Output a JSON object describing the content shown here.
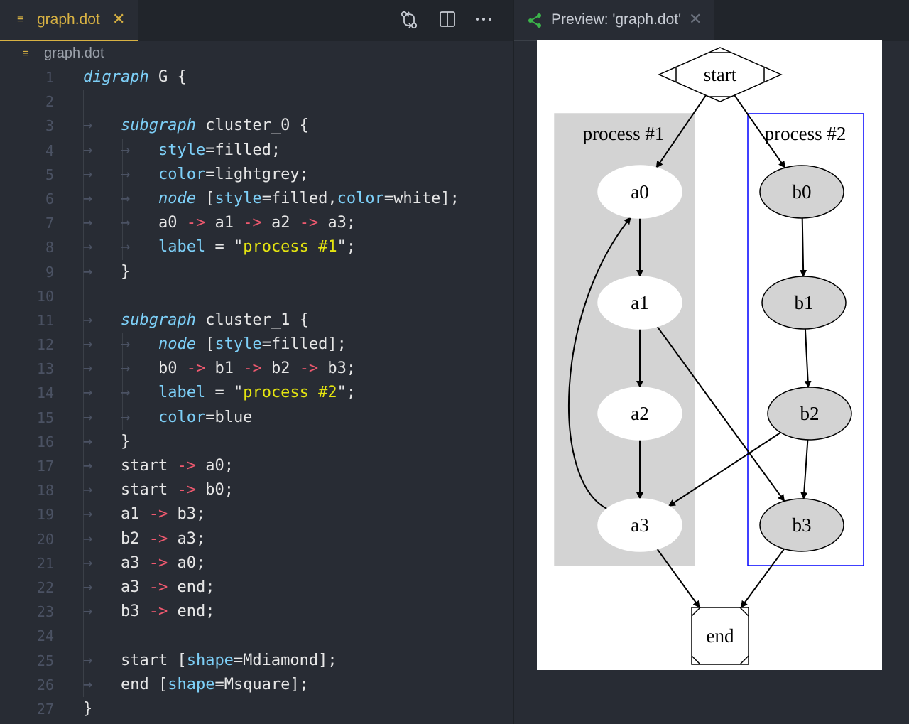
{
  "editor": {
    "tab": {
      "icon": "lines-file-icon",
      "filename": "graph.dot",
      "close_glyph": "✕"
    },
    "actions": [
      {
        "name": "open-changes-icon",
        "glyph": "⇄"
      },
      {
        "name": "split-editor-icon",
        "glyph": "▢"
      },
      {
        "name": "more-actions-icon",
        "glyph": "···"
      }
    ],
    "breadcrumb": {
      "label": "graph.dot"
    }
  },
  "preview": {
    "tab_title": "Preview: 'graph.dot'",
    "close_glyph": "✕",
    "icon": "graph-preview-icon",
    "accent": "#3bb54a"
  },
  "code_lines": [
    {
      "n": "1",
      "indent": 0,
      "tokens": [
        [
          "kw",
          "digraph"
        ],
        [
          "p",
          " G {"
        ]
      ]
    },
    {
      "n": "2",
      "indent": 1,
      "tokens": []
    },
    {
      "n": "3",
      "indent": 1,
      "tokens": [
        [
          "kw",
          "subgraph"
        ],
        [
          "p",
          " cluster_0 {"
        ]
      ]
    },
    {
      "n": "4",
      "indent": 2,
      "tokens": [
        [
          "at",
          "style"
        ],
        [
          "p",
          "=filled;"
        ]
      ]
    },
    {
      "n": "5",
      "indent": 2,
      "tokens": [
        [
          "at",
          "color"
        ],
        [
          "p",
          "=lightgrey;"
        ]
      ]
    },
    {
      "n": "6",
      "indent": 2,
      "tokens": [
        [
          "kw",
          "node"
        ],
        [
          "p",
          " ["
        ],
        [
          "at",
          "style"
        ],
        [
          "p",
          "=filled,"
        ],
        [
          "at",
          "color"
        ],
        [
          "p",
          "=white];"
        ]
      ]
    },
    {
      "n": "7",
      "indent": 2,
      "tokens": [
        [
          "p",
          "a0 "
        ],
        [
          "ar",
          "->"
        ],
        [
          "p",
          " a1 "
        ],
        [
          "ar",
          "->"
        ],
        [
          "p",
          " a2 "
        ],
        [
          "ar",
          "->"
        ],
        [
          "p",
          " a3;"
        ]
      ]
    },
    {
      "n": "8",
      "indent": 2,
      "tokens": [
        [
          "at",
          "label"
        ],
        [
          "p",
          " = "
        ],
        [
          "sq",
          "\""
        ],
        [
          "st",
          "process #1"
        ],
        [
          "sq",
          "\""
        ],
        [
          "p",
          ";"
        ]
      ]
    },
    {
      "n": "9",
      "indent": 1,
      "tokens": [
        [
          "p",
          "}"
        ]
      ]
    },
    {
      "n": "10",
      "indent": 1,
      "tokens": []
    },
    {
      "n": "11",
      "indent": 1,
      "tokens": [
        [
          "kw",
          "subgraph"
        ],
        [
          "p",
          " cluster_1 {"
        ]
      ]
    },
    {
      "n": "12",
      "indent": 2,
      "tokens": [
        [
          "kw",
          "node"
        ],
        [
          "p",
          " ["
        ],
        [
          "at",
          "style"
        ],
        [
          "p",
          "=filled];"
        ]
      ]
    },
    {
      "n": "13",
      "indent": 2,
      "tokens": [
        [
          "p",
          "b0 "
        ],
        [
          "ar",
          "->"
        ],
        [
          "p",
          " b1 "
        ],
        [
          "ar",
          "->"
        ],
        [
          "p",
          " b2 "
        ],
        [
          "ar",
          "->"
        ],
        [
          "p",
          " b3;"
        ]
      ]
    },
    {
      "n": "14",
      "indent": 2,
      "tokens": [
        [
          "at",
          "label"
        ],
        [
          "p",
          " = "
        ],
        [
          "sq",
          "\""
        ],
        [
          "st",
          "process #2"
        ],
        [
          "sq",
          "\""
        ],
        [
          "p",
          ";"
        ]
      ]
    },
    {
      "n": "15",
      "indent": 2,
      "tokens": [
        [
          "at",
          "color"
        ],
        [
          "p",
          "=blue"
        ]
      ]
    },
    {
      "n": "16",
      "indent": 1,
      "tokens": [
        [
          "p",
          "}"
        ]
      ]
    },
    {
      "n": "17",
      "indent": 1,
      "tokens": [
        [
          "p",
          "start "
        ],
        [
          "ar",
          "->"
        ],
        [
          "p",
          " a0;"
        ]
      ]
    },
    {
      "n": "18",
      "indent": 1,
      "tokens": [
        [
          "p",
          "start "
        ],
        [
          "ar",
          "->"
        ],
        [
          "p",
          " b0;"
        ]
      ]
    },
    {
      "n": "19",
      "indent": 1,
      "tokens": [
        [
          "p",
          "a1 "
        ],
        [
          "ar",
          "->"
        ],
        [
          "p",
          " b3;"
        ]
      ]
    },
    {
      "n": "20",
      "indent": 1,
      "tokens": [
        [
          "p",
          "b2 "
        ],
        [
          "ar",
          "->"
        ],
        [
          "p",
          " a3;"
        ]
      ]
    },
    {
      "n": "21",
      "indent": 1,
      "tokens": [
        [
          "p",
          "a3 "
        ],
        [
          "ar",
          "->"
        ],
        [
          "p",
          " a0;"
        ]
      ]
    },
    {
      "n": "22",
      "indent": 1,
      "tokens": [
        [
          "p",
          "a3 "
        ],
        [
          "ar",
          "->"
        ],
        [
          "p",
          " end;"
        ]
      ]
    },
    {
      "n": "23",
      "indent": 1,
      "tokens": [
        [
          "p",
          "b3 "
        ],
        [
          "ar",
          "->"
        ],
        [
          "p",
          " end;"
        ]
      ]
    },
    {
      "n": "24",
      "indent": 1,
      "tokens": []
    },
    {
      "n": "25",
      "indent": 1,
      "tokens": [
        [
          "p",
          "start ["
        ],
        [
          "at",
          "shape"
        ],
        [
          "p",
          "=Mdiamond];"
        ]
      ]
    },
    {
      "n": "26",
      "indent": 1,
      "tokens": [
        [
          "p",
          "end ["
        ],
        [
          "at",
          "shape"
        ],
        [
          "p",
          "=Msquare];"
        ]
      ]
    },
    {
      "n": "27",
      "indent": 0,
      "tokens": [
        [
          "p",
          "}"
        ]
      ]
    }
  ],
  "graph": {
    "clusters": [
      {
        "id": "cluster_0",
        "label": "process #1",
        "fill": "#d3d3d3",
        "stroke": "#d3d3d3"
      },
      {
        "id": "cluster_1",
        "label": "process #2",
        "fill": "none",
        "stroke": "#0000ff"
      }
    ],
    "nodes": [
      {
        "id": "start",
        "label": "start",
        "shape": "Mdiamond"
      },
      {
        "id": "a0",
        "label": "a0",
        "shape": "ellipse",
        "fill": "#ffffff",
        "stroke": "#ffffff"
      },
      {
        "id": "a1",
        "label": "a1",
        "shape": "ellipse",
        "fill": "#ffffff",
        "stroke": "#ffffff"
      },
      {
        "id": "a2",
        "label": "a2",
        "shape": "ellipse",
        "fill": "#ffffff",
        "stroke": "#ffffff"
      },
      {
        "id": "a3",
        "label": "a3",
        "shape": "ellipse",
        "fill": "#ffffff",
        "stroke": "#ffffff"
      },
      {
        "id": "b0",
        "label": "b0",
        "shape": "ellipse",
        "fill": "#d3d3d3",
        "stroke": "#000000"
      },
      {
        "id": "b1",
        "label": "b1",
        "shape": "ellipse",
        "fill": "#d3d3d3",
        "stroke": "#000000"
      },
      {
        "id": "b2",
        "label": "b2",
        "shape": "ellipse",
        "fill": "#d3d3d3",
        "stroke": "#000000"
      },
      {
        "id": "b3",
        "label": "b3",
        "shape": "ellipse",
        "fill": "#d3d3d3",
        "stroke": "#000000"
      },
      {
        "id": "end",
        "label": "end",
        "shape": "Msquare"
      }
    ],
    "edges": [
      [
        "start",
        "a0"
      ],
      [
        "start",
        "b0"
      ],
      [
        "a0",
        "a1"
      ],
      [
        "a1",
        "a2"
      ],
      [
        "a2",
        "a3"
      ],
      [
        "b0",
        "b1"
      ],
      [
        "b1",
        "b2"
      ],
      [
        "b2",
        "b3"
      ],
      [
        "a1",
        "b3"
      ],
      [
        "b2",
        "a3"
      ],
      [
        "a3",
        "a0"
      ],
      [
        "a3",
        "end"
      ],
      [
        "b3",
        "end"
      ]
    ]
  }
}
